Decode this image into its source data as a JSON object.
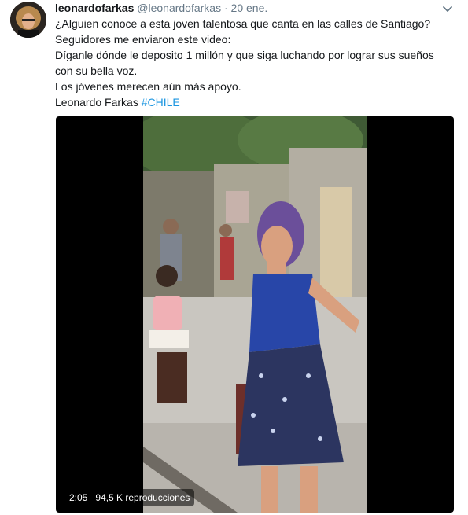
{
  "tweet": {
    "display_name": "leonardofarkas",
    "handle": "@leonardofarkas",
    "separator": "·",
    "date": "20 ene.",
    "lines": [
      "¿Alguien conoce a esta joven talentosa que canta en las calles de Santiago?",
      "Seguidores me enviaron este video:",
      "Díganle dónde le deposito 1 millón y que siga luchando por lograr sus sueños",
      "con su bella voz.",
      "Los jóvenes merecen aún más apoyo."
    ],
    "signature": "Leonardo Farkas",
    "hashtag": "#CHILE"
  },
  "video": {
    "duration": "2:05",
    "views": "94,5 K reproducciones"
  },
  "icons": {
    "menu": "chevron-down-icon"
  },
  "colors": {
    "link": "#1b95e0",
    "secondary_text": "#657786"
  }
}
